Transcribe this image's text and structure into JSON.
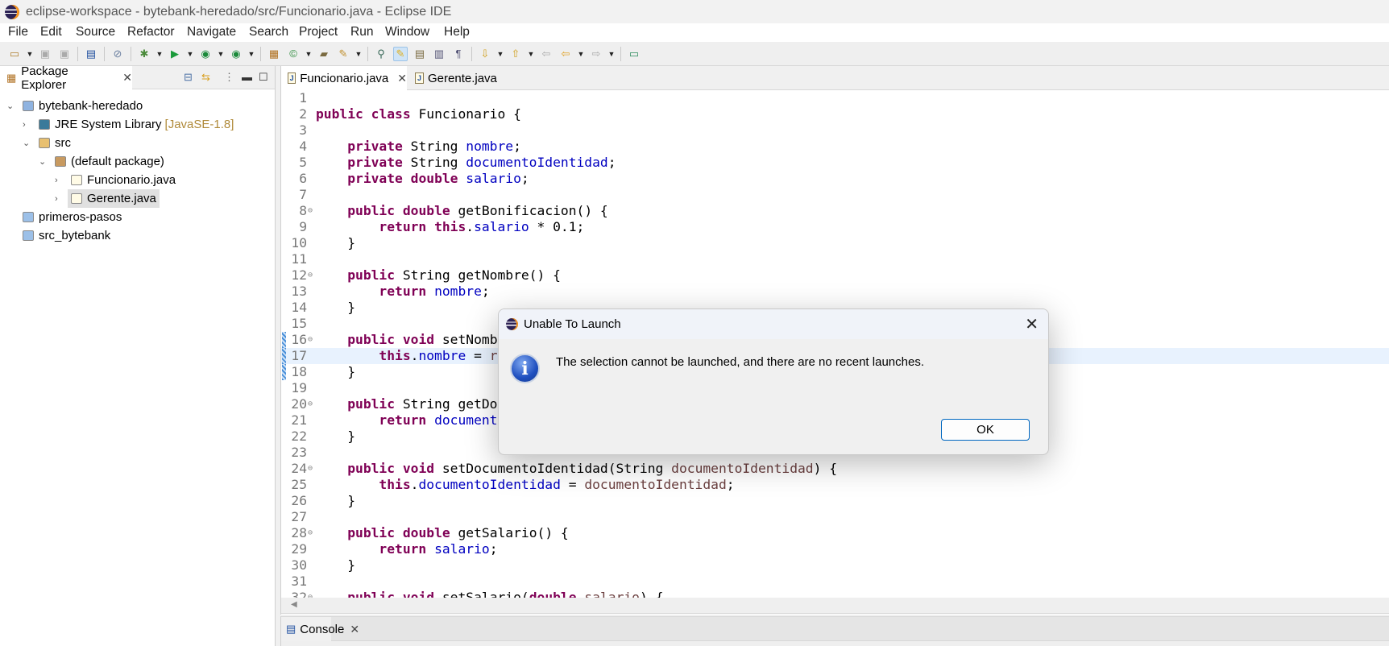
{
  "window": {
    "title": "eclipse-workspace - bytebank-heredado/src/Funcionario.java - Eclipse IDE"
  },
  "menu": [
    "File",
    "Edit",
    "Source",
    "Refactor",
    "Navigate",
    "Search",
    "Project",
    "Run",
    "Window",
    "Help"
  ],
  "toolbar": {
    "icons": [
      "new-icon",
      "save-icon",
      "save-all-icon",
      "terminal-icon",
      "skip-breakpoints-icon",
      "debug-icon",
      "run-icon",
      "coverage-icon",
      "external-tools-icon",
      "new-java-package-icon",
      "new-java-class-icon",
      "open-type-icon",
      "search-icon",
      "toggle-breadcrumb-icon",
      "mark-occurrences-icon",
      "block-selection-icon",
      "word-wrap-icon",
      "show-whitespace-icon",
      "next-annotation-icon",
      "previous-annotation-icon",
      "last-edit-icon",
      "back-icon",
      "forward-icon",
      "pin-editor-icon"
    ]
  },
  "package_explorer": {
    "tab_label": "Package Explorer",
    "tree": [
      {
        "label": "bytebank-heredado",
        "decoration": "",
        "level": 0,
        "expanded": true,
        "icon": "project-icon"
      },
      {
        "label": "JRE System Library",
        "decoration": "[JavaSE-1.8]",
        "level": 1,
        "expanded": false,
        "icon": "library-icon"
      },
      {
        "label": "src",
        "decoration": "",
        "level": 1,
        "expanded": true,
        "icon": "source-folder-icon"
      },
      {
        "label": "(default package)",
        "decoration": "",
        "level": 2,
        "expanded": true,
        "icon": "package-icon"
      },
      {
        "label": "Funcionario.java",
        "decoration": "",
        "level": 3,
        "expanded": false,
        "icon": "java-file-icon"
      },
      {
        "label": "Gerente.java",
        "decoration": "",
        "level": 3,
        "expanded": false,
        "icon": "java-file-icon",
        "selected": true
      },
      {
        "label": "primeros-pasos",
        "decoration": "",
        "level": 0,
        "icon": "folder-icon"
      },
      {
        "label": "src_bytebank",
        "decoration": "",
        "level": 0,
        "icon": "folder-icon"
      }
    ]
  },
  "editor": {
    "tabs": [
      {
        "label": "Funcionario.java",
        "active": true
      },
      {
        "label": "Gerente.java",
        "active": false
      }
    ],
    "current_line": 17,
    "changed_lines": [
      16,
      17,
      18
    ],
    "folds": [
      8,
      12,
      16,
      20,
      24,
      28,
      32
    ],
    "lines": [
      [],
      [
        [
          "kw",
          "public"
        ],
        [
          "pl",
          " "
        ],
        [
          "kw",
          "class"
        ],
        [
          "pl",
          " Funcionario {"
        ]
      ],
      [],
      [
        [
          "pl",
          "    "
        ],
        [
          "kw",
          "private"
        ],
        [
          "pl",
          " String "
        ],
        [
          "fd",
          "nombre"
        ],
        [
          "pl",
          ";"
        ]
      ],
      [
        [
          "pl",
          "    "
        ],
        [
          "kw",
          "private"
        ],
        [
          "pl",
          " String "
        ],
        [
          "fd",
          "documentoIdentidad"
        ],
        [
          "pl",
          ";"
        ]
      ],
      [
        [
          "pl",
          "    "
        ],
        [
          "kw",
          "private"
        ],
        [
          "pl",
          " "
        ],
        [
          "kw",
          "double"
        ],
        [
          "pl",
          " "
        ],
        [
          "fd",
          "salario"
        ],
        [
          "pl",
          ";"
        ]
      ],
      [],
      [
        [
          "pl",
          "    "
        ],
        [
          "kw",
          "public"
        ],
        [
          "pl",
          " "
        ],
        [
          "kw",
          "double"
        ],
        [
          "pl",
          " getBonificacion() {"
        ]
      ],
      [
        [
          "pl",
          "        "
        ],
        [
          "kw",
          "return"
        ],
        [
          "pl",
          " "
        ],
        [
          "kw",
          "this"
        ],
        [
          "pl",
          "."
        ],
        [
          "fd",
          "salario"
        ],
        [
          "pl",
          " * 0.1;"
        ]
      ],
      [
        [
          "pl",
          "    }"
        ]
      ],
      [],
      [
        [
          "pl",
          "    "
        ],
        [
          "kw",
          "public"
        ],
        [
          "pl",
          " String getNombre() {"
        ]
      ],
      [
        [
          "pl",
          "        "
        ],
        [
          "kw",
          "return"
        ],
        [
          "pl",
          " "
        ],
        [
          "fd",
          "nombre"
        ],
        [
          "pl",
          ";"
        ]
      ],
      [
        [
          "pl",
          "    }"
        ]
      ],
      [],
      [
        [
          "pl",
          "    "
        ],
        [
          "kw",
          "public"
        ],
        [
          "pl",
          " "
        ],
        [
          "kw",
          "void"
        ],
        [
          "pl",
          " setNomb"
        ]
      ],
      [
        [
          "pl",
          "        "
        ],
        [
          "kw",
          "this"
        ],
        [
          "pl",
          "."
        ],
        [
          "fd",
          "nombre"
        ],
        [
          "pl",
          " = "
        ],
        [
          "pm",
          "r"
        ]
      ],
      [
        [
          "pl",
          "    }"
        ]
      ],
      [],
      [
        [
          "pl",
          "    "
        ],
        [
          "kw",
          "public"
        ],
        [
          "pl",
          " String getDo"
        ]
      ],
      [
        [
          "pl",
          "        "
        ],
        [
          "kw",
          "return"
        ],
        [
          "pl",
          " "
        ],
        [
          "fd",
          "document"
        ]
      ],
      [
        [
          "pl",
          "    }"
        ]
      ],
      [],
      [
        [
          "pl",
          "    "
        ],
        [
          "kw",
          "public"
        ],
        [
          "pl",
          " "
        ],
        [
          "kw",
          "void"
        ],
        [
          "pl",
          " setDocumentoIdentidad(String "
        ],
        [
          "pm",
          "documentoIdentidad"
        ],
        [
          "pl",
          ") {"
        ]
      ],
      [
        [
          "pl",
          "        "
        ],
        [
          "kw",
          "this"
        ],
        [
          "pl",
          "."
        ],
        [
          "fd",
          "documentoIdentidad"
        ],
        [
          "pl",
          " = "
        ],
        [
          "pm",
          "documentoIdentidad"
        ],
        [
          "pl",
          ";"
        ]
      ],
      [
        [
          "pl",
          "    }"
        ]
      ],
      [],
      [
        [
          "pl",
          "    "
        ],
        [
          "kw",
          "public"
        ],
        [
          "pl",
          " "
        ],
        [
          "kw",
          "double"
        ],
        [
          "pl",
          " getSalario() {"
        ]
      ],
      [
        [
          "pl",
          "        "
        ],
        [
          "kw",
          "return"
        ],
        [
          "pl",
          " "
        ],
        [
          "fd",
          "salario"
        ],
        [
          "pl",
          ";"
        ]
      ],
      [
        [
          "pl",
          "    }"
        ]
      ],
      [],
      [
        [
          "pl",
          "    "
        ],
        [
          "kw",
          "public"
        ],
        [
          "pl",
          " "
        ],
        [
          "kw",
          "void"
        ],
        [
          "pl",
          " setSalario("
        ],
        [
          "kw",
          "double"
        ],
        [
          "pl",
          " "
        ],
        [
          "pm",
          "salario"
        ],
        [
          "pl",
          ") {"
        ]
      ]
    ]
  },
  "console": {
    "tab_label": "Console"
  },
  "dialog": {
    "title": "Unable To Launch",
    "message": "The selection cannot be launched, and there are no recent launches.",
    "ok_label": "OK",
    "icon": "info-icon"
  },
  "colors": {
    "keyword": "#7f0055",
    "field": "#0000c0",
    "parameter": "#6a3e3e",
    "current_line": "#e8f2fe",
    "ok_border": "#0067c0"
  }
}
